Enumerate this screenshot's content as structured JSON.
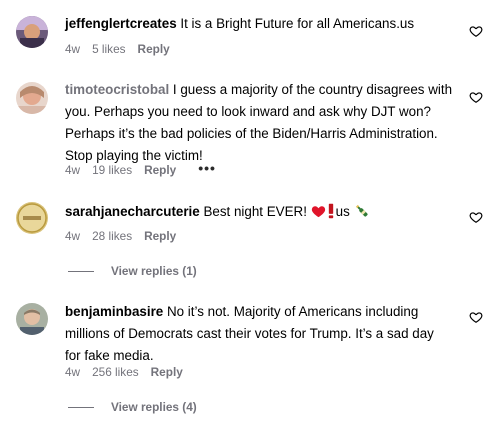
{
  "comments": [
    {
      "username": "jeffenglertcreates",
      "text": "It is a Bright Future for all Americans.us",
      "age": "4w",
      "likes": "5 likes",
      "reply": "Reply"
    },
    {
      "username": "timoteocristobal",
      "text": "I guess a majority of the country disagrees with you. Perhaps you need to look inward and ask why DJT won? Perhaps it’s the bad policies of the Biden/Harris Administration. Stop playing the victim!",
      "age": "4w",
      "likes": "19 likes",
      "reply": "Reply",
      "more": "•••"
    },
    {
      "username": "sarahjanecharcuterie",
      "text": "Best night EVER!",
      "text_suffix": "us",
      "age": "4w",
      "likes": "28 likes",
      "reply": "Reply",
      "view_replies": "View replies (1)"
    },
    {
      "username": "benjaminbasire",
      "text": "No it’s not. Majority of Americans including millions of Democrats cast their votes for Trump. It’s a sad day for fake media.",
      "age": "4w",
      "likes": "256 likes",
      "reply": "Reply",
      "view_replies": "View replies (4)"
    }
  ],
  "icons": {
    "like": "heart-outline-icon",
    "emoji_1": "red-heart-emoji",
    "emoji_2": "exclamation-emoji",
    "emoji_3": "champagne-bottle-emoji"
  },
  "colors": {
    "text": "#000000",
    "muted": "#73737b"
  }
}
